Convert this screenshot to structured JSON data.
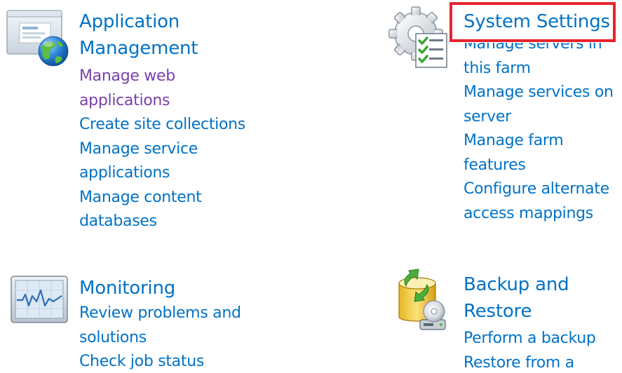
{
  "sections": {
    "application_management": {
      "title_line1": "Application",
      "title_line2": "Management",
      "links": [
        "Manage web applications",
        "Create site collections",
        "Manage service applications",
        "Manage content databases"
      ]
    },
    "system_settings": {
      "title": "System Settings",
      "links": [
        "Manage servers in this farm",
        "Manage services on server",
        "Manage farm features",
        "Configure alternate access mappings"
      ]
    },
    "monitoring": {
      "title": "Monitoring",
      "links": [
        "Review problems and solutions",
        "Check job status"
      ]
    },
    "backup_restore": {
      "title_line1": "Backup and",
      "title_line2": "Restore",
      "links": [
        "Perform a backup",
        "Restore from a"
      ]
    }
  },
  "colors": {
    "link": "#0072c6",
    "visited_link": "#7b3fa8",
    "highlight": "#e8232c"
  },
  "icons": {
    "application_management": "browser-globe-icon",
    "system_settings": "gear-checklist-icon",
    "monitoring": "monitor-chart-icon",
    "backup_restore": "database-sync-icon"
  }
}
